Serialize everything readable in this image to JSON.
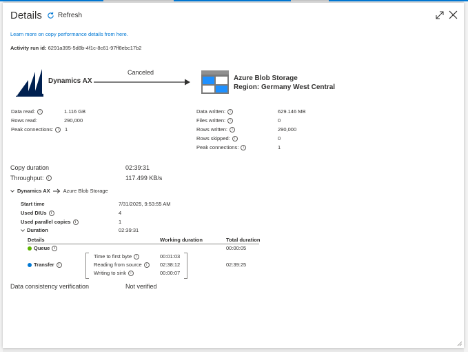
{
  "header": {
    "title": "Details",
    "refresh_label": "Refresh"
  },
  "links": {
    "learn_more": "Learn more on copy performance details from here."
  },
  "activity": {
    "run_id_label": "Activity run id:",
    "run_id_value": "6291a395-5d8b-4f1c-8c61-97ff8ebc17b2"
  },
  "flow": {
    "source_name": "Dynamics AX",
    "status": "Canceled",
    "sink_name": "Azure Blob Storage",
    "sink_region": "Region: Germany West Central"
  },
  "source_stats": [
    {
      "label": "Data read:",
      "value": "1.116 GB"
    },
    {
      "label": "Rows read:",
      "value": "290,000"
    },
    {
      "label": "Peak connections:",
      "value": "1"
    }
  ],
  "sink_stats": [
    {
      "label": "Data written:",
      "value": "629.146 MB"
    },
    {
      "label": "Files written:",
      "value": "0"
    },
    {
      "label": "Rows written:",
      "value": "290,000"
    },
    {
      "label": "Rows skipped:",
      "value": "0"
    },
    {
      "label": "Peak connections:",
      "value": "1"
    }
  ],
  "summary": {
    "copy_duration_label": "Copy duration",
    "copy_duration_value": "02:39:31",
    "throughput_label": "Throughput:",
    "throughput_value": "117.499 KB/s"
  },
  "pipeline_section": {
    "source": "Dynamics AX",
    "sink": "Azure Blob Storage",
    "details": [
      {
        "label": "Start time",
        "value": "7/31/2025, 9:53:55 AM"
      },
      {
        "label": "Used DIUs",
        "value": "4"
      },
      {
        "label": "Used parallel copies",
        "value": "1"
      }
    ],
    "duration_label": "Duration",
    "duration_value": "02:39:31",
    "table": {
      "headers": [
        "Details",
        "Working duration",
        "Total duration"
      ],
      "queue_label": "Queue",
      "queue_total": "00:00:05",
      "transfer_label": "Transfer",
      "transfer_total": "02:39:25",
      "transfer_steps": [
        {
          "label": "Time to first byte",
          "value": "00:01:03"
        },
        {
          "label": "Reading from source",
          "value": "02:38:12"
        },
        {
          "label": "Writing to sink",
          "value": "00:00:07"
        }
      ]
    }
  },
  "verification": {
    "label": "Data consistency verification",
    "value": "Not verified"
  },
  "colors": {
    "accent": "#0078d4",
    "queue_status": "#5db300",
    "transfer_status": "#0078d4",
    "dynamics_logo": "#002050"
  },
  "icons": [
    "refresh-icon",
    "expand-icon",
    "close-icon",
    "info-icon",
    "chevron-down-icon",
    "arrow-right-icon",
    "dynamics-ax-logo",
    "blob-storage-icon",
    "resize-grip-icon"
  ]
}
